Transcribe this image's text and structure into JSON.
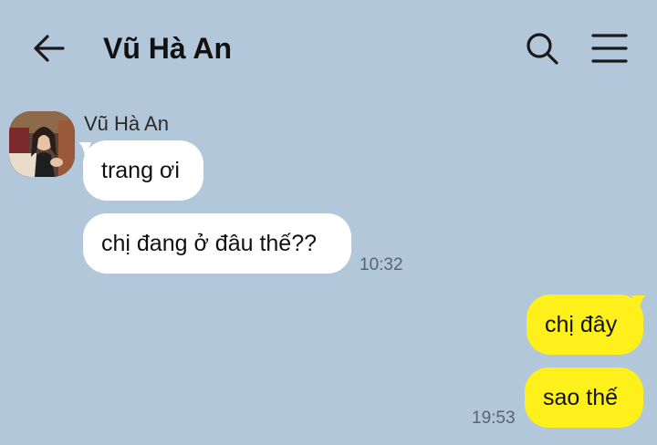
{
  "header": {
    "title": "Vũ Hà An",
    "back_icon": "arrow-left-icon",
    "search_icon": "search-icon",
    "menu_icon": "menu-icon"
  },
  "colors": {
    "background": "#b2c7d9",
    "incoming_bubble": "#ffffff",
    "outgoing_bubble": "#fef01b",
    "timestamp": "#566574"
  },
  "conversation": {
    "incoming": {
      "sender": "Vũ Hà An",
      "messages": [
        "trang ơi",
        "chị đang ở đâu thế??"
      ],
      "time": "10:32"
    },
    "outgoing": {
      "messages": [
        "chị đây",
        "sao thế"
      ],
      "time": "19:53"
    }
  }
}
